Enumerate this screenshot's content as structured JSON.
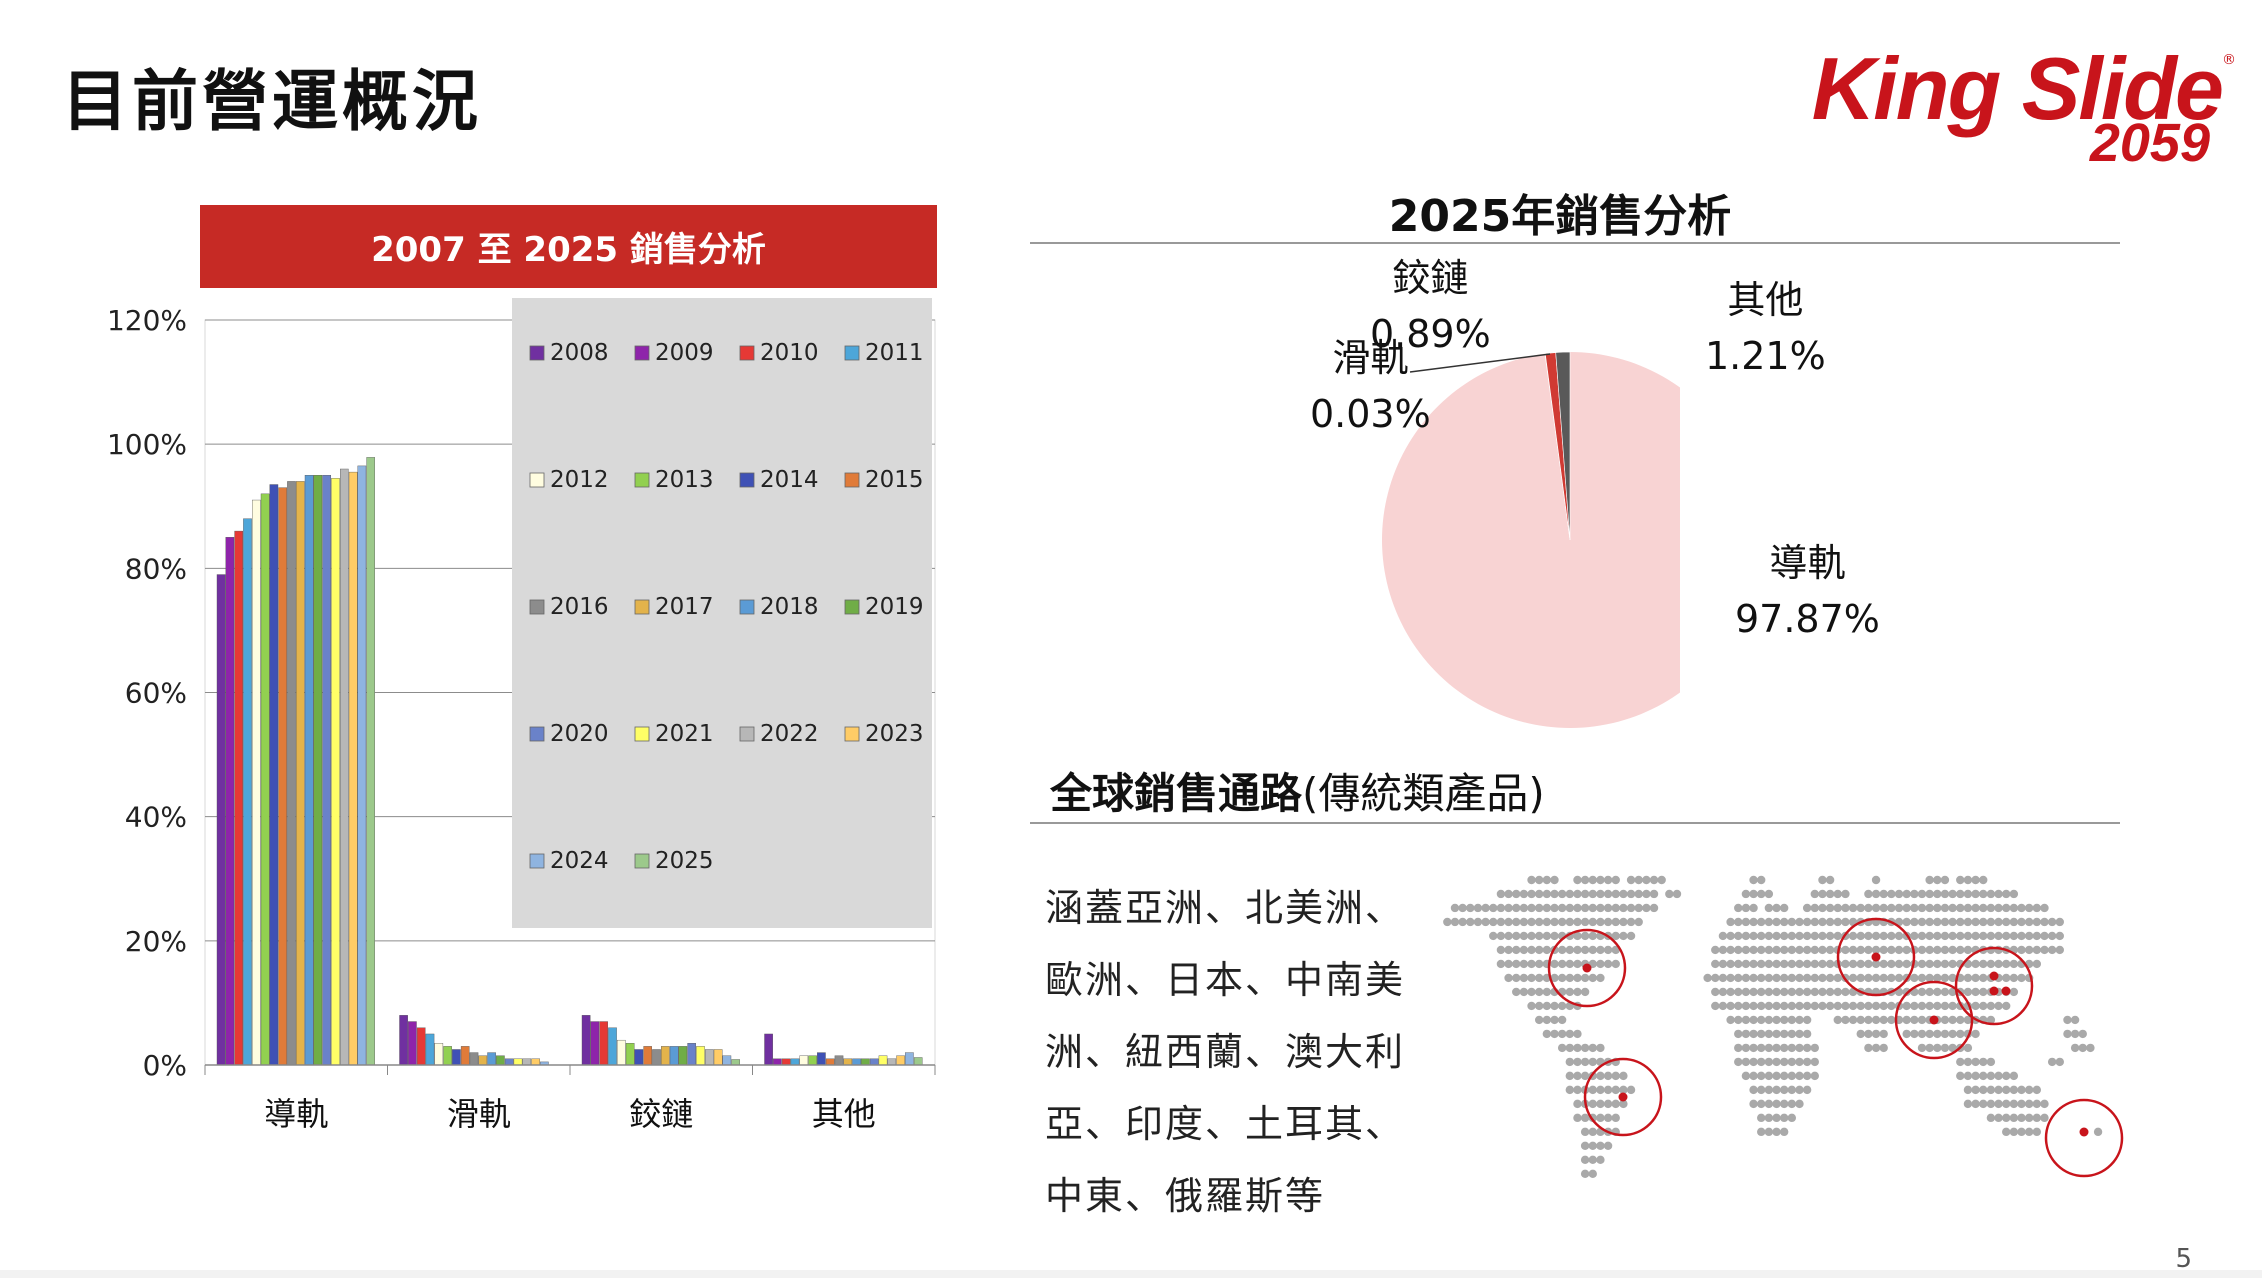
{
  "page": {
    "title": "目前營運概況",
    "page_number": "5"
  },
  "logo": {
    "name": "King Slide",
    "registered": "®",
    "ticker": "2059",
    "color": "#c8141b"
  },
  "bar_section": {
    "banner": "2007 至 2025 銷售分析",
    "banner_color": "#c62a25"
  },
  "pie_section": {
    "title": "2025年銷售分析"
  },
  "channels": {
    "title_bold": "全球銷售通路",
    "title_rest": "(傳統類產品)",
    "lines": [
      "涵蓋亞洲、北美洲、",
      "歐洲、日本、中南美",
      "洲、紐西蘭、澳大利",
      "亞、印度、土耳其、",
      "中東、俄羅斯等"
    ]
  },
  "chart_data": [
    {
      "type": "bar",
      "title": "2007 至 2025 銷售分析",
      "categories": [
        "導軌",
        "滑軌",
        "鉸鏈",
        "其他"
      ],
      "ylim": [
        0,
        120
      ],
      "yticks": [
        "0%",
        "20%",
        "40%",
        "60%",
        "80%",
        "100%",
        "120%"
      ],
      "grid": true,
      "legend_position": "top-right",
      "series": [
        {
          "name": "2008",
          "color": "#7030a0",
          "values": [
            79,
            8,
            8,
            5
          ]
        },
        {
          "name": "2009",
          "color": "#8e24aa",
          "values": [
            85,
            7,
            7,
            1
          ]
        },
        {
          "name": "2010",
          "color": "#e53935",
          "values": [
            86,
            6,
            7,
            1
          ]
        },
        {
          "name": "2011",
          "color": "#4da6d9",
          "values": [
            88,
            5,
            6,
            1
          ]
        },
        {
          "name": "2012",
          "color": "#fffde0",
          "values": [
            91,
            3.5,
            4,
            1.5
          ]
        },
        {
          "name": "2013",
          "color": "#92d050",
          "values": [
            92,
            3,
            3.5,
            1.5
          ]
        },
        {
          "name": "2014",
          "color": "#3f51b5",
          "values": [
            93.5,
            2.5,
            2.5,
            2
          ]
        },
        {
          "name": "2015",
          "color": "#e07b39",
          "values": [
            93,
            3,
            3,
            1
          ]
        },
        {
          "name": "2016",
          "color": "#8c8c8c",
          "values": [
            94,
            2,
            2.5,
            1.5
          ]
        },
        {
          "name": "2017",
          "color": "#e3b34b",
          "values": [
            94,
            1.5,
            3,
            1
          ]
        },
        {
          "name": "2018",
          "color": "#5b9bd5",
          "values": [
            95,
            2,
            3,
            1
          ]
        },
        {
          "name": "2019",
          "color": "#70ad47",
          "values": [
            95,
            1.5,
            3,
            1
          ]
        },
        {
          "name": "2020",
          "color": "#6a82c9",
          "values": [
            95,
            1,
            3.5,
            1
          ]
        },
        {
          "name": "2021",
          "color": "#ffff66",
          "values": [
            94.5,
            1,
            3,
            1.5
          ]
        },
        {
          "name": "2022",
          "color": "#b7b7b7",
          "values": [
            96,
            1,
            2.5,
            1
          ]
        },
        {
          "name": "2023",
          "color": "#ffcc66",
          "values": [
            95.5,
            1,
            2.5,
            1.5
          ]
        },
        {
          "name": "2024",
          "color": "#8fb4e0",
          "values": [
            96.5,
            0.5,
            1.5,
            2
          ]
        },
        {
          "name": "2025",
          "color": "#9cc98b",
          "values": [
            97.87,
            0.03,
            0.89,
            1.21
          ]
        }
      ]
    },
    {
      "type": "pie",
      "title": "2025年銷售分析",
      "slices": [
        {
          "label": "導軌",
          "value": 97.87,
          "value_label": "97.87%",
          "color": "#f8d3d3"
        },
        {
          "label": "滑軌",
          "value": 0.03,
          "value_label": "0.03%",
          "color": "#a0a0a0"
        },
        {
          "label": "鉸鏈",
          "value": 0.89,
          "value_label": "0.89%",
          "color": "#d03a33"
        },
        {
          "label": "其他",
          "value": 1.21,
          "value_label": "1.21%",
          "color": "#595959"
        }
      ]
    }
  ]
}
